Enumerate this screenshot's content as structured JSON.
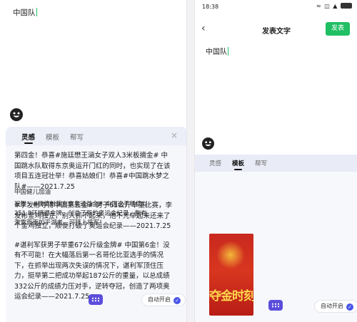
{
  "left": {
    "input_text": "中国队",
    "tabs": [
      "灵感",
      "模板",
      "帮写"
    ],
    "close_glyph": "×",
    "paragraphs": [
      "第四金！恭喜#施廷懋王涵女子双人3米板摘金# 中国跳水队取得东京奥运开门红的同时，也实现了在该项目五连冠壮举！恭喜姑娘们！恭喜#中国跳水梦之队#——2021.7.25",
      "#李发彬夺得中国第五金# 男子61公斤举重比赛，李发彬金鸡独立，别人抓不起来，他不光举起来还来了个金鸡独立，顺便打破了奥运会纪录——2021.7.25",
      "#谌利军获男子举重67公斤级金牌# 中国第6金！没有不可能！在大幅落后第一名哥伦比亚选手的情况下，在抓举出现两次失误的情况下，谌利军顶住压力，挺举第二把成功举起187公斤的重量，以总成绩332公斤的成绩力压对手，逆转夺冠，创造了两项奥运会纪录——2021.7.25"
    ],
    "auto_label": "自动开启",
    "check_glyph": "✓"
  },
  "right": {
    "status": {
      "time": "18:38",
      "icons": "≈ ◫ ▲"
    },
    "back_glyph": "‹",
    "title": "发表文字",
    "send_label": "发表",
    "input_text": "中国队",
    "tabs": [
      "灵感",
      "模板",
      "帮写"
    ],
    "card_title": "中国健儿加油",
    "card_text": "祝贺！#杨倩射落东京奥运首金# 中国选手杨倩以251.8环摘得金牌，创造了新的奥运会纪录，胸有激雷而面如平湖者，可拜上将军！",
    "poster_text": "夺金时刻",
    "auto_label": "自动开启",
    "check_glyph": "✓"
  },
  "colors": {
    "accent_green": "#1fbf63",
    "accent_purple": "#5b4ddc",
    "check_blue": "#4a55e8",
    "poster_red": "#c8281e"
  },
  "icons": [
    "smiley-icon",
    "keyboard-icon",
    "close-icon",
    "back-icon",
    "wifi-icon",
    "battery-icon",
    "check-icon"
  ]
}
